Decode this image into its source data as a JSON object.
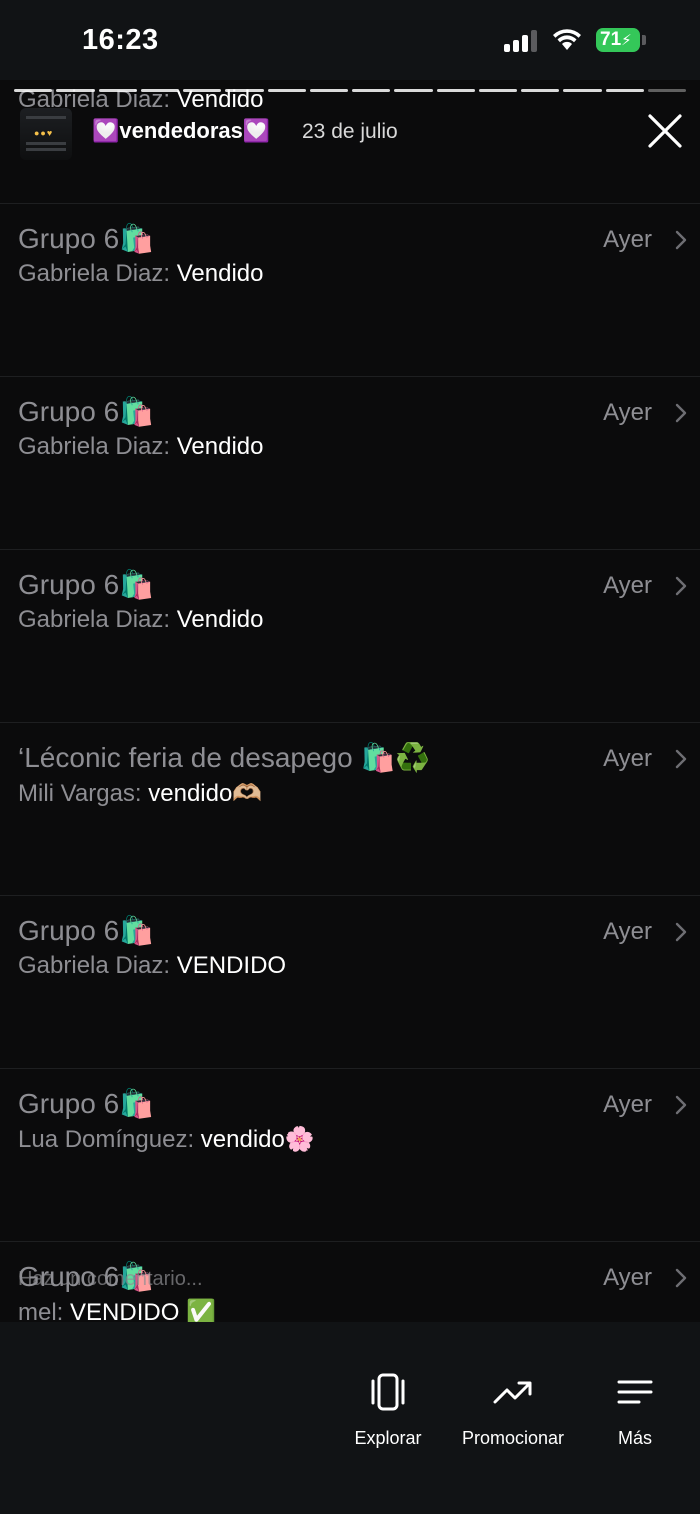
{
  "status_bar": {
    "time": "16:23",
    "battery": "71"
  },
  "story": {
    "account_name": "💟vendedoras💟",
    "date": "23 de julio",
    "ghost_sender": "Gabriela Diaz:",
    "ghost_message": "Vendido"
  },
  "chats": [
    {
      "title": "Grupo 6🛍️",
      "sender": "Gabriela Diaz:",
      "message": "Vendido",
      "time": "Ayer"
    },
    {
      "title": "Grupo 6🛍️",
      "sender": "Gabriela Diaz:",
      "message": "Vendido",
      "time": "Ayer"
    },
    {
      "title": "Grupo 6🛍️",
      "sender": "Gabriela Diaz:",
      "message": "Vendido",
      "time": "Ayer"
    },
    {
      "title": "‘Léconic feria de desapego 🛍️♻️",
      "sender": "Mili Vargas:",
      "message": "vendido🫶🏼",
      "time": "Ayer"
    },
    {
      "title": "Grupo 6🛍️",
      "sender": "Gabriela Diaz:",
      "message": "VENDIDO",
      "time": "Ayer"
    },
    {
      "title": "Grupo 6🛍️",
      "sender": "Lua Domínguez:",
      "message": "vendido🌸",
      "time": "Ayer"
    },
    {
      "title": "Grupo 6🛍️",
      "sender": "mel:",
      "message": "VENDIDO ✅",
      "time": "Ayer"
    }
  ],
  "comment_placeholder": "Haz un comentario...",
  "bottom_bar": {
    "explore_label": "Explorar",
    "promote_label": "Promocionar",
    "more_label": "Más"
  },
  "colors": {
    "background": "#0b0b0c",
    "secondary_text": "#8e8e93",
    "battery": "#34c759"
  }
}
